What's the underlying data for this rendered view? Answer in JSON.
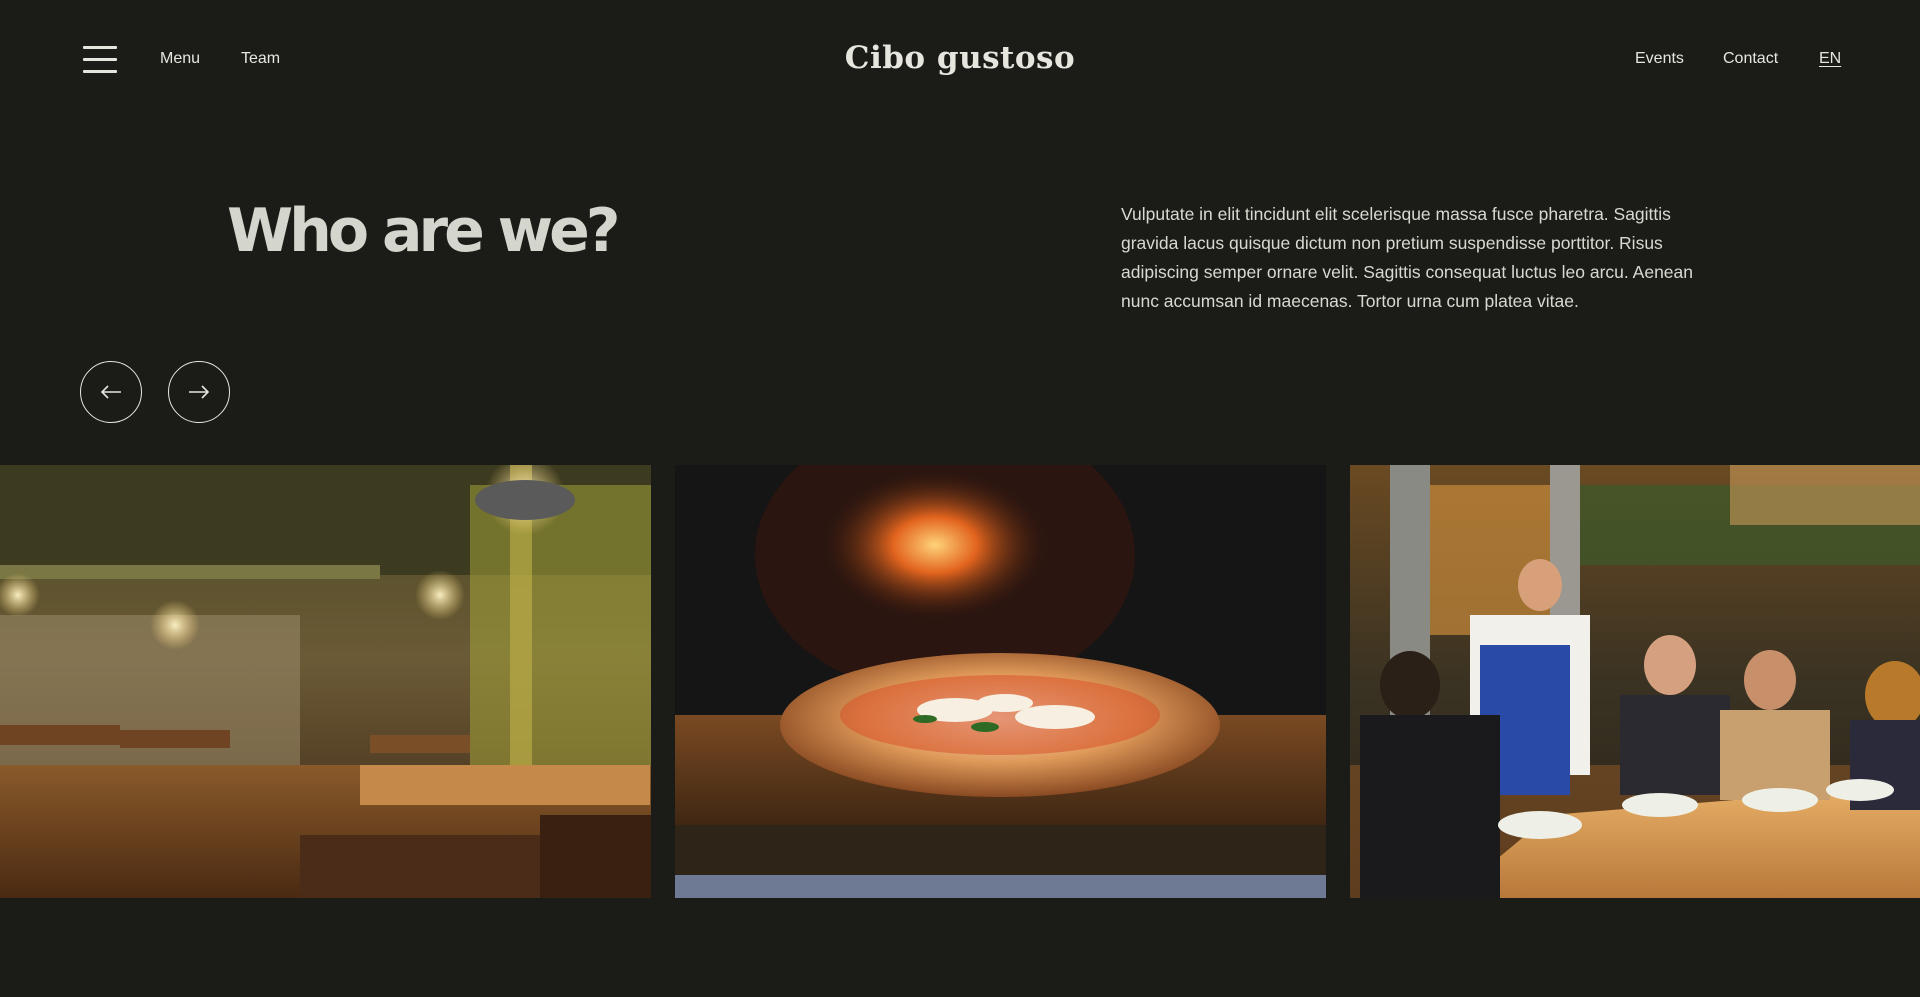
{
  "header": {
    "logo": "Cibo gustoso",
    "nav_left": [
      "Menu",
      "Team"
    ],
    "nav_right": [
      "Events",
      "Contact"
    ],
    "language": "EN"
  },
  "hero": {
    "title": "Who are we?",
    "description": "Vulputate in elit tincidunt elit scelerisque massa fusce pharetra. Sagittis gravida lacus quisque dictum non pretium suspendisse porttitor. Risus adipiscing semper ornare velit. Sagittis consequat luctus leo arcu. Aenean nunc accumsan id maecenas. Tortor urna cum platea vitae."
  },
  "carousel": {
    "prev_icon": "arrow-left-icon",
    "next_icon": "arrow-right-icon"
  },
  "gallery": [
    {
      "subject": "restaurant-interior-photo"
    },
    {
      "subject": "pizza-photo"
    },
    {
      "subject": "diners-photo"
    }
  ],
  "colors": {
    "background": "#1b1c17",
    "text": "#e6e6df",
    "title": "#d4d5cc"
  }
}
